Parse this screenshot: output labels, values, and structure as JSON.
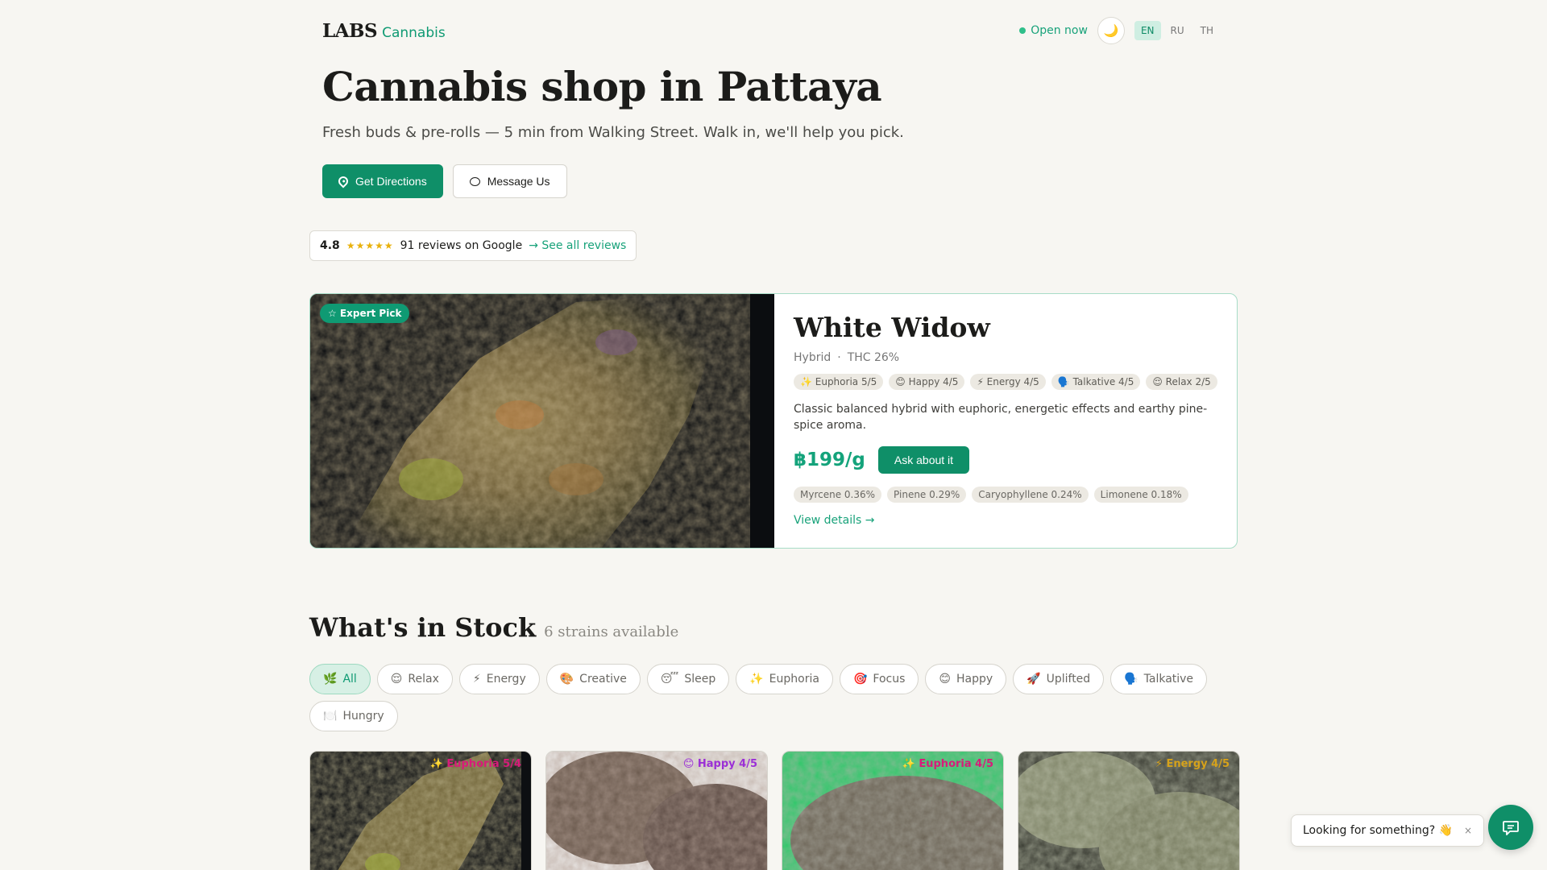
{
  "header": {
    "logo_main": "LABS",
    "logo_sub": "Cannabis",
    "status": "Open now",
    "theme_icon": "🌙",
    "languages": [
      "EN",
      "RU",
      "TH"
    ],
    "active_language": "EN"
  },
  "hero": {
    "title": "Cannabis shop in Pattaya",
    "subtitle": "Fresh buds & pre-rolls — 5 min from Walking Street. Walk in, we'll help you pick.",
    "directions_label": "Get Directions",
    "message_label": "Message Us"
  },
  "rating": {
    "score": "4.8",
    "stars": "★★★★★",
    "reviews": "91 reviews on Google",
    "link": "→ See all reviews"
  },
  "featured": {
    "badge": "☆ Expert Pick",
    "name": "White Widow",
    "type": "Hybrid",
    "thc": "THC 26%",
    "effects": [
      "✨ Euphoria 5/5",
      "😊 Happy 4/5",
      "⚡ Energy 4/5",
      "🗣️ Talkative 4/5",
      "😌 Relax 2/5"
    ],
    "description": "Classic balanced hybrid with euphoric, energetic effects and earthy pine-spice aroma.",
    "price": "฿199/g",
    "ask_label": "Ask about it",
    "terpenes": [
      "Myrcene 0.36%",
      "Pinene 0.29%",
      "Caryophyllene 0.24%",
      "Limonene 0.18%"
    ],
    "view_details": "View details →"
  },
  "stock": {
    "title": "What's in Stock",
    "count": "6 strains available",
    "filters": [
      {
        "icon": "🌿",
        "label": "All",
        "active": true
      },
      {
        "icon": "😌",
        "label": "Relax"
      },
      {
        "icon": "⚡",
        "label": "Energy"
      },
      {
        "icon": "🎨",
        "label": "Creative"
      },
      {
        "icon": "😴",
        "label": "Sleep"
      },
      {
        "icon": "✨",
        "label": "Euphoria"
      },
      {
        "icon": "🎯",
        "label": "Focus"
      },
      {
        "icon": "😊",
        "label": "Happy"
      },
      {
        "icon": "🚀",
        "label": "Uplifted"
      },
      {
        "icon": "🗣️",
        "label": "Talkative"
      },
      {
        "icon": "🍽️",
        "label": "Hungry"
      }
    ],
    "products": [
      {
        "tag": "✨ Euphoria 5/4",
        "tag_color": "#d81b7a"
      },
      {
        "tag": "😊 Happy 4/5",
        "tag_color": "#9b2fd6"
      },
      {
        "tag": "✨ Euphoria 4/5",
        "tag_color": "#d81b7a"
      },
      {
        "tag": "⚡ Energy 4/5",
        "tag_color": "#d6a21b"
      }
    ]
  },
  "chat": {
    "prompt": "Looking for something? 👋",
    "close": "×"
  },
  "colors": {
    "accent": "#0f8f68",
    "accent_light": "#18a27a",
    "background": "#f7f6f2"
  }
}
